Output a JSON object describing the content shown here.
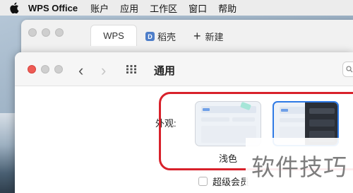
{
  "menubar": {
    "app_name": "WPS Office",
    "items": [
      "账户",
      "应用",
      "工作区",
      "窗口",
      "帮助"
    ]
  },
  "wps_window": {
    "tabs": {
      "wps": "WPS",
      "docer": "稻壳",
      "docer_icon_letter": "D",
      "new": "新建"
    }
  },
  "preferences": {
    "title": "通用",
    "appearance_label": "外观:",
    "themes": [
      {
        "name": "浅色",
        "selected": false
      },
      {
        "selected": true
      }
    ],
    "super_member_label": "超级会员"
  },
  "watermark": "软件技巧",
  "colors": {
    "highlight_frame": "#d8212b",
    "selected_border": "#2f7ae5",
    "close_light": "#ee5b55"
  }
}
